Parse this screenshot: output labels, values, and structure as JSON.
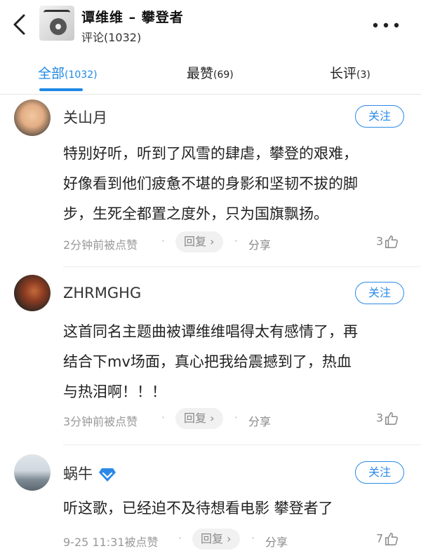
{
  "header": {
    "title": "谭维维 – 攀登者",
    "subtitle": "评论(1032)"
  },
  "tabs": [
    {
      "label": "全部",
      "count": "(1032)"
    },
    {
      "label": "最赞",
      "count": "(69)"
    },
    {
      "label": "长评",
      "count": "(3)"
    }
  ],
  "follow_label": "关注",
  "reply_label": "回复",
  "share_label": "分享",
  "comments": [
    {
      "name": "关山月",
      "lines": [
        "特别好听，听到了风雪的肆虐，攀登的艰难，",
        "好像看到他们疲惫不堪的身影和坚韧不拔的脚",
        "步，生死全都置之度外，只为国旗飘扬。"
      ],
      "time": "2分钟前被点赞",
      "likes": "3"
    },
    {
      "name": "ZHRMGHG",
      "lines": [
        "这首同名主题曲被谭维维唱得太有感情了，再",
        "结合下mv场面，真心把我给震撼到了，热血",
        "与热泪啊！！！"
      ],
      "time": "3分钟前被点赞",
      "likes": "3"
    },
    {
      "name": "蜗牛",
      "lines": [
        "听这歌，已经迫不及待想看电影 攀登者了"
      ],
      "time": "9-25 11:31被点赞",
      "likes": "7"
    }
  ],
  "colors": {
    "accent": "#1e88e5",
    "muted": "#999999"
  }
}
